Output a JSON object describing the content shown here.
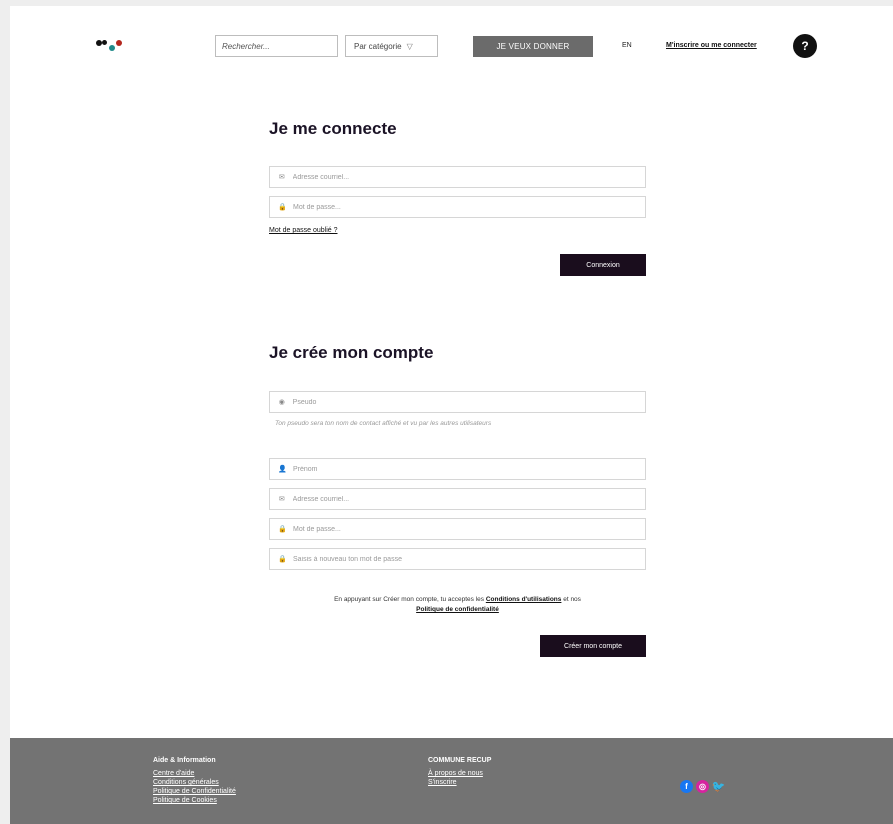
{
  "header": {
    "search_placeholder": "Rechercher...",
    "category_label": "Par catégorie",
    "give_button": "JE VEUX DONNER",
    "language": "EN",
    "auth_link": "M'inscrire ou me connecter",
    "help_label": "?"
  },
  "login": {
    "title": "Je me connecte",
    "email_placeholder": "Adresse courriel...",
    "password_placeholder": "Mot de passe...",
    "forgot_link": "Mot de passe oublié ?",
    "submit": "Connexion"
  },
  "register": {
    "title": "Je crée mon compte",
    "pseudo_placeholder": "Pseudo",
    "pseudo_hint": "Ton pseudo sera ton nom de contact affiché et vu par les autres utilisateurs",
    "firstname_placeholder": "Prénom",
    "email_placeholder": "Adresse courriel...",
    "password_placeholder": "Mot de passe...",
    "password_confirm_placeholder": "Saisis à nouveau ton mot de passe",
    "legal_text_1": "En appuyant sur Créer mon compte, tu acceptes les",
    "legal_link_1": "Conditions d'utilisations",
    "legal_text_2": "et nos",
    "legal_link_2": "Politique de confidentialité",
    "submit": "Créer mon compte"
  },
  "footer": {
    "col1": {
      "heading": "Aide & Information",
      "links": [
        "Centre d'aide",
        "Conditions générales",
        "Politique de Confidentialité",
        "Politique de Cookies"
      ]
    },
    "col2": {
      "heading": "COMMUNE RECUP",
      "links": [
        "À propos de nous",
        "S'inscrire"
      ]
    },
    "social": {
      "facebook": "f",
      "instagram": "◎",
      "twitter": "🐦"
    }
  },
  "colors": {
    "primary_dark": "#1a0d1d",
    "footer_bg": "#737373",
    "give_button_bg": "#6b6b6b"
  }
}
